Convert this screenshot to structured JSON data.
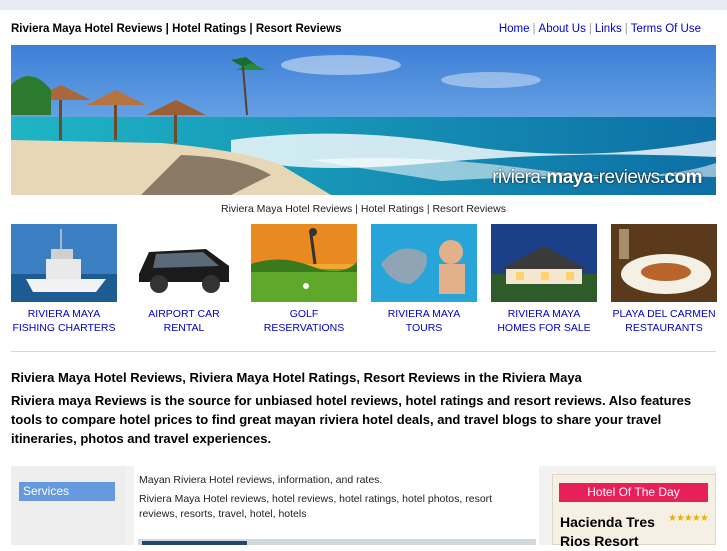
{
  "header": {
    "site_title": "Riviera Maya Hotel Reviews | Hotel Ratings | Resort Reviews",
    "nav": [
      {
        "label": "Home"
      },
      {
        "label": "About Us"
      },
      {
        "label": "Links"
      },
      {
        "label": "Terms Of Use"
      }
    ]
  },
  "banner": {
    "url_prefix": "riviera-",
    "url_bold": "maya",
    "url_suffix": "-reviews",
    "url_tld": ".com"
  },
  "subtitle": "Riviera Maya Hotel Reviews | Hotel Ratings | Resort Reviews",
  "tiles": [
    {
      "line1": "Riviera Maya",
      "line2": "Fishing Charters"
    },
    {
      "line1": "Airport Car",
      "line2": "Rental"
    },
    {
      "line1": "Golf",
      "line2": "Reservations"
    },
    {
      "line1": "Riviera Maya",
      "line2": "Tours"
    },
    {
      "line1": "Riviera Maya",
      "line2": "Homes For Sale"
    },
    {
      "line1": "Playa del Carmen",
      "line2": "Restaurants"
    }
  ],
  "main": {
    "heading": "Riviera Maya Hotel Reviews, Riviera Maya Hotel Ratings, Resort Reviews in the Riviera Maya",
    "intro": "Riviera maya Reviews is the source for unbiased hotel reviews, hotel ratings and resort reviews. Also features tools to compare hotel prices to find great mayan riviera hotel deals, and travel blogs to share your travel itineraries, photos and travel experiences."
  },
  "sidebar": {
    "services_label": "Services"
  },
  "center": {
    "line1": "Mayan Riviera Hotel reviews, information, and rates.",
    "line2": "Riviera Maya Hotel reviews, hotel reviews, hotel ratings, hotel photos, resort reviews, resorts, travel, hotel, hotels"
  },
  "hotel_of_day": {
    "title": "Hotel Of The Day",
    "name": "Hacienda Tres Rios Resort",
    "stars": "★★★★★"
  },
  "colors": {
    "link": "#0000cc",
    "services_bg": "#6699dd",
    "hotel_badge": "#e8205a"
  }
}
